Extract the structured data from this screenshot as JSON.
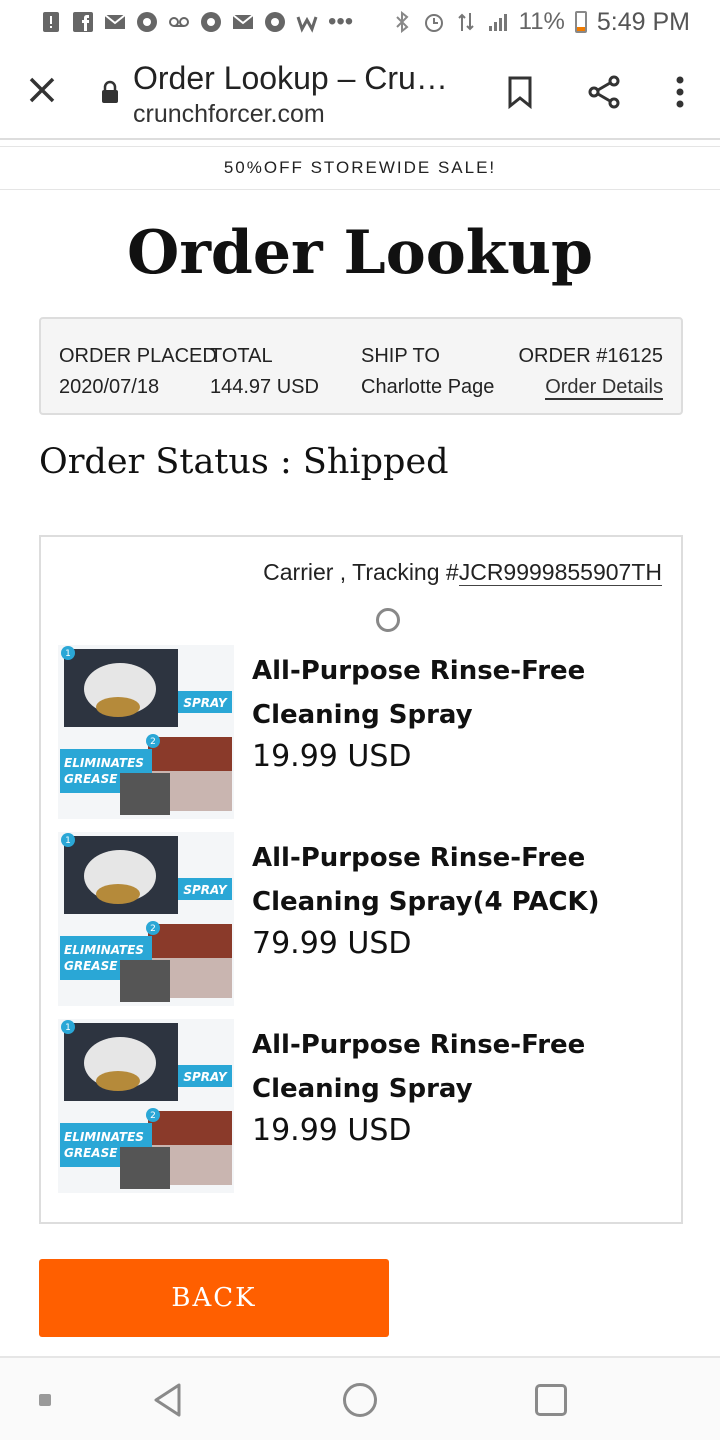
{
  "status_bar": {
    "battery": "11%",
    "time": "5:49 PM",
    "more": "•••"
  },
  "browser": {
    "tab_title": "Order Lookup – Cru…",
    "url": "crunchforcer.com"
  },
  "banner": {
    "text": "50%OFF STOREWIDE SALE!"
  },
  "page": {
    "title": "Order Lookup"
  },
  "order": {
    "placed_label": "ORDER PLACED",
    "placed_value": "2020/07/18",
    "total_label": "TOTAL",
    "total_value": "144.97 USD",
    "ship_to_label": "SHIP TO",
    "ship_to_value": "Charlotte Page",
    "order_number": "ORDER #16125",
    "details_link": "Order Details"
  },
  "status": {
    "text": "Order Status : Shipped"
  },
  "tracking": {
    "prefix": "Carrier , Tracking #",
    "number": "JCR9999855907TH"
  },
  "items": [
    {
      "name": "All-Purpose Rinse-Free Cleaning Spray",
      "price": "19.99 USD"
    },
    {
      "name": "All-Purpose Rinse-Free Cleaning Spray(4 PACK)",
      "price": "79.99 USD"
    },
    {
      "name": "All-Purpose Rinse-Free Cleaning Spray",
      "price": "19.99 USD"
    }
  ],
  "thumb": {
    "badge_top": "SPRAY",
    "badge_bottom_1": "ELIMINATES",
    "badge_bottom_2": "GREASE",
    "step1": "1",
    "step2": "2"
  },
  "back_button": {
    "label": "BACK"
  },
  "colors": {
    "accent": "#ff5f00",
    "thumb_badge": "#2aa7d6"
  }
}
